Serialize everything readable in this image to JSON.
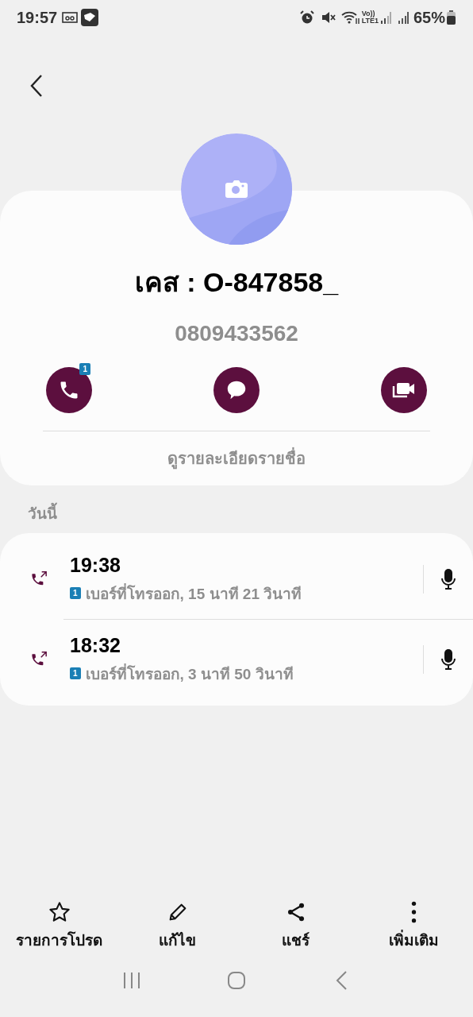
{
  "status_bar": {
    "time": "19:57",
    "volte_top": "Vo))",
    "volte_bottom": "LTE1",
    "battery": "65%"
  },
  "contact": {
    "name": "เคส : O-847858_",
    "number": "0809433562",
    "call_badge": "1",
    "actions": [
      {
        "kind": "call"
      },
      {
        "kind": "message"
      },
      {
        "kind": "video"
      }
    ],
    "details_link": "ดูรายละเอียดรายชื่อ"
  },
  "section_title": "วันนี้",
  "calls": [
    {
      "time": "19:38",
      "sim": "1",
      "detail": "เบอร์ที่โทรออก, 15 นาที 21 วินาที"
    },
    {
      "time": "18:32",
      "sim": "1",
      "detail": "เบอร์ที่โทรออก, 3 นาที 50 วินาที"
    }
  ],
  "bottom_actions": [
    {
      "kind": "star",
      "label": "รายการโปรด"
    },
    {
      "kind": "edit",
      "label": "แก้ไข"
    },
    {
      "kind": "share",
      "label": "แชร์"
    },
    {
      "kind": "more",
      "label": "เพิ่มเติม"
    }
  ]
}
